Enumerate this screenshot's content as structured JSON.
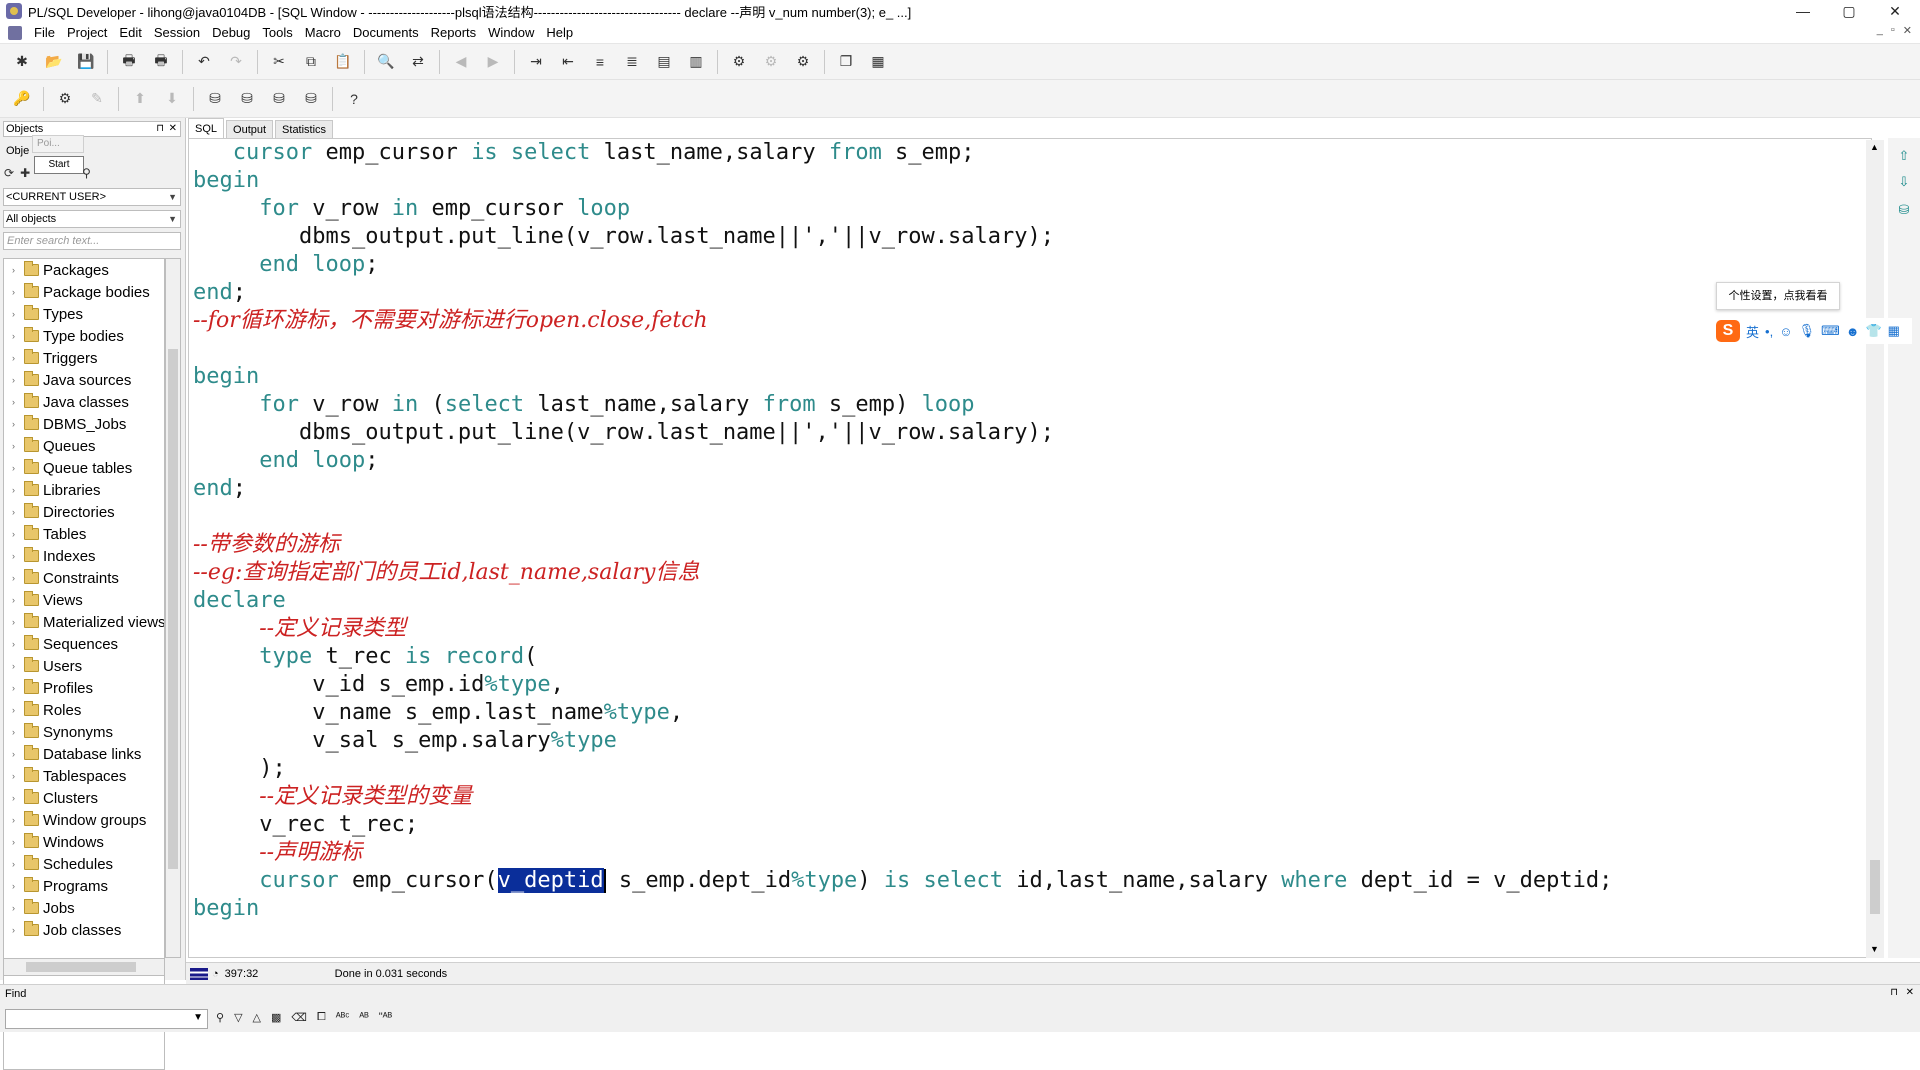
{
  "window": {
    "title": "PL/SQL Developer - lihong@java0104DB - [SQL Window - --------------------plsql语法结构---------------------------------- declare --声明 v_num number(3); e_ ...]",
    "minimize": "—",
    "maximize": "▢",
    "close": "✕"
  },
  "menu": {
    "items": [
      "File",
      "Project",
      "Edit",
      "Session",
      "Debug",
      "Tools",
      "Macro",
      "Documents",
      "Reports",
      "Window",
      "Help"
    ],
    "mdi_minimize": "_",
    "mdi_restore": "▫",
    "mdi_close": "✕"
  },
  "left_panel": {
    "header": "Objects",
    "pin": "⊓",
    "close": "✕",
    "subtab": "Obje",
    "tooltip_ghost": "Poi...",
    "tooltip_start": "Start",
    "user_select": "<CURRENT USER>",
    "filter_select": "All objects",
    "search_placeholder": "Enter search text...",
    "tree": [
      "Packages",
      "Package bodies",
      "Types",
      "Type bodies",
      "Triggers",
      "Java sources",
      "Java classes",
      "DBMS_Jobs",
      "Queues",
      "Queue tables",
      "Libraries",
      "Directories",
      "Tables",
      "Indexes",
      "Constraints",
      "Views",
      "Materialized views",
      "Sequences",
      "Users",
      "Profiles",
      "Roles",
      "Synonyms",
      "Database links",
      "Tablespaces",
      "Clusters",
      "Window groups",
      "Windows",
      "Schedules",
      "Programs",
      "Jobs",
      "Job classes"
    ]
  },
  "editor": {
    "tabs": [
      "SQL",
      "Output",
      "Statistics"
    ],
    "lines": [
      {
        "y": 0,
        "indent": "   ",
        "tokens": [
          [
            "kw",
            "cursor"
          ],
          [
            "tx",
            " emp_cursor "
          ],
          [
            "kw",
            "is select"
          ],
          [
            "tx",
            " last_name,salary "
          ],
          [
            "kw",
            "from"
          ],
          [
            "tx",
            " s_emp;"
          ]
        ]
      },
      {
        "y": 1,
        "indent": "",
        "tokens": [
          [
            "kw",
            "begin"
          ]
        ]
      },
      {
        "y": 2,
        "indent": "     ",
        "tokens": [
          [
            "kw",
            "for"
          ],
          [
            "tx",
            " v_row "
          ],
          [
            "kw",
            "in"
          ],
          [
            "tx",
            " emp_cursor "
          ],
          [
            "kw",
            "loop"
          ]
        ]
      },
      {
        "y": 3,
        "indent": "        ",
        "tokens": [
          [
            "tx",
            "dbms_output.put_line(v_row.last_name||','||v_row.salary);"
          ]
        ]
      },
      {
        "y": 4,
        "indent": "     ",
        "tokens": [
          [
            "kw",
            "end loop"
          ],
          [
            "tx",
            ";"
          ]
        ]
      },
      {
        "y": 5,
        "indent": "",
        "tokens": [
          [
            "kw",
            "end"
          ],
          [
            "tx",
            ";"
          ]
        ]
      },
      {
        "y": 6,
        "indent": "",
        "tokens": [
          [
            "cm",
            "--for循环游标，不需要对游标进行open.close,fetch"
          ]
        ]
      },
      {
        "y": 8,
        "indent": "",
        "tokens": [
          [
            "kw",
            "begin"
          ]
        ]
      },
      {
        "y": 9,
        "indent": "     ",
        "tokens": [
          [
            "kw",
            "for"
          ],
          [
            "tx",
            " v_row "
          ],
          [
            "kw",
            "in"
          ],
          [
            "tx",
            " ("
          ],
          [
            "kw",
            "select"
          ],
          [
            "tx",
            " last_name,salary "
          ],
          [
            "kw",
            "from"
          ],
          [
            "tx",
            " s_emp) "
          ],
          [
            "kw",
            "loop"
          ]
        ]
      },
      {
        "y": 10,
        "indent": "        ",
        "tokens": [
          [
            "tx",
            "dbms_output.put_line(v_row.last_name||','||v_row.salary);"
          ]
        ]
      },
      {
        "y": 11,
        "indent": "     ",
        "tokens": [
          [
            "kw",
            "end loop"
          ],
          [
            "tx",
            ";"
          ]
        ]
      },
      {
        "y": 12,
        "indent": "",
        "tokens": [
          [
            "kw",
            "end"
          ],
          [
            "tx",
            ";"
          ]
        ]
      },
      {
        "y": 14,
        "indent": "",
        "tokens": [
          [
            "cm",
            "--带参数的游标"
          ]
        ]
      },
      {
        "y": 15,
        "indent": "",
        "tokens": [
          [
            "cm",
            "--eg:查询指定部门的员工id,last_name,salary信息"
          ]
        ]
      },
      {
        "y": 16,
        "indent": "",
        "tokens": [
          [
            "kw",
            "declare"
          ]
        ]
      },
      {
        "y": 17,
        "indent": "     ",
        "tokens": [
          [
            "cm",
            "--定义记录类型"
          ]
        ]
      },
      {
        "y": 18,
        "indent": "     ",
        "tokens": [
          [
            "kw",
            "type"
          ],
          [
            "tx",
            " t_rec "
          ],
          [
            "kw",
            "is record"
          ],
          [
            "tx",
            "("
          ]
        ]
      },
      {
        "y": 19,
        "indent": "         ",
        "tokens": [
          [
            "tx",
            "v_id s_emp.id"
          ],
          [
            "kw",
            "%type"
          ],
          [
            "tx",
            ","
          ]
        ]
      },
      {
        "y": 20,
        "indent": "         ",
        "tokens": [
          [
            "tx",
            "v_name s_emp.last_name"
          ],
          [
            "kw",
            "%type"
          ],
          [
            "tx",
            ","
          ]
        ]
      },
      {
        "y": 21,
        "indent": "         ",
        "tokens": [
          [
            "tx",
            "v_sal s_emp.salary"
          ],
          [
            "kw",
            "%type"
          ]
        ]
      },
      {
        "y": 22,
        "indent": "     ",
        "tokens": [
          [
            "tx",
            ");"
          ]
        ]
      },
      {
        "y": 23,
        "indent": "     ",
        "tokens": [
          [
            "cm",
            "--定义记录类型的变量"
          ]
        ]
      },
      {
        "y": 24,
        "indent": "     ",
        "tokens": [
          [
            "tx",
            "v_rec t_rec;"
          ]
        ]
      },
      {
        "y": 25,
        "indent": "     ",
        "tokens": [
          [
            "cm",
            "--声明游标"
          ]
        ]
      },
      {
        "y": 26,
        "indent": "     ",
        "tokens": [
          [
            "kw",
            "cursor"
          ],
          [
            "tx",
            " emp_cursor("
          ],
          [
            "sel",
            "v_deptid"
          ],
          [
            "cur",
            ""
          ],
          [
            "tx",
            " s_emp.dept_id"
          ],
          [
            "kw",
            "%type"
          ],
          [
            "tx",
            ") "
          ],
          [
            "kw",
            "is select"
          ],
          [
            "tx",
            " id,last_name,salary "
          ],
          [
            "kw",
            "where"
          ],
          [
            "tx",
            " dept_id = v_deptid;"
          ]
        ]
      },
      {
        "y": 27,
        "indent": "",
        "tokens": [
          [
            "kw",
            "begin"
          ]
        ]
      }
    ]
  },
  "status": {
    "position": "397:32",
    "message": "Done in 0.031 seconds"
  },
  "find": {
    "label": "Find",
    "pin": "⊓",
    "close": "✕"
  },
  "ime": {
    "tip": "个性设置，点我看看",
    "logo": "S",
    "mode": "英"
  }
}
